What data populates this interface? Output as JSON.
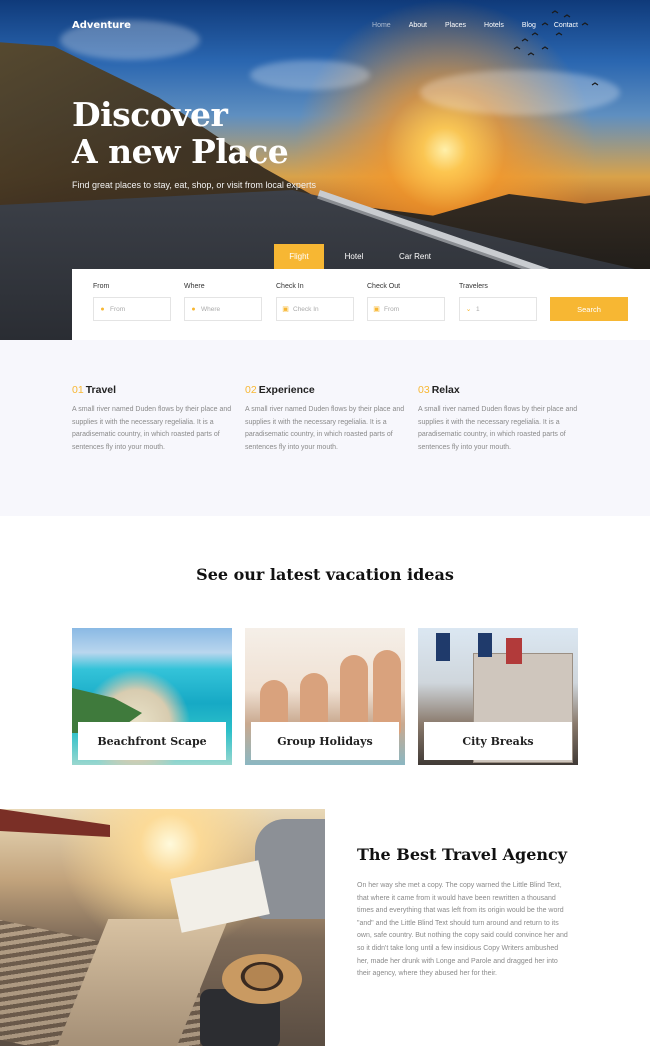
{
  "nav": {
    "brand": "Adventure",
    "items": [
      "Home",
      "About",
      "Places",
      "Hotels",
      "Blog",
      "Contact"
    ],
    "active_item": "Home"
  },
  "hero": {
    "title_line1": "Discover",
    "title_line2": "A new Place",
    "subtitle": "Find great places to stay, eat, shop, or visit from local experts"
  },
  "search": {
    "tabs": [
      "Flight",
      "Hotel",
      "Car Rent"
    ],
    "active_tab": "Flight",
    "fields": [
      {
        "label": "From",
        "placeholder": "From",
        "icon": "location-pin-icon"
      },
      {
        "label": "Where",
        "placeholder": "Where",
        "icon": "location-pin-icon"
      },
      {
        "label": "Check In",
        "placeholder": "Check In",
        "icon": "calendar-icon"
      },
      {
        "label": "Check Out",
        "placeholder": "From",
        "icon": "calendar-icon"
      },
      {
        "label": "Travelers",
        "placeholder": "1",
        "icon": "chevron-down-icon"
      }
    ],
    "button": "Search"
  },
  "features": [
    {
      "num": "01",
      "title": "Travel",
      "text": "A small river named Duden flows by their place and supplies it with the necessary regelialia. It is a paradisematic country, in which roasted parts of sentences fly into your mouth."
    },
    {
      "num": "02",
      "title": "Experience",
      "text": "A small river named Duden flows by their place and supplies it with the necessary regelialia. It is a paradisematic country, in which roasted parts of sentences fly into your mouth."
    },
    {
      "num": "03",
      "title": "Relax",
      "text": "A small river named Duden flows by their place and supplies it with the necessary regelialia. It is a paradisematic country, in which roasted parts of sentences fly into your mouth."
    }
  ],
  "vacation": {
    "title": "See our latest vacation ideas",
    "cards": [
      "Beachfront Scape",
      "Group Holidays",
      "City Breaks"
    ]
  },
  "agency": {
    "title": "The Best Travel Agency",
    "text": "On her way she met a copy. The copy warned the Little Blind Text, that where it came from it would have been rewritten a thousand times and everything that was left from its origin would be the word \"and\" and the Little Blind Text should turn around and return to its own, safe country. But nothing the copy said could convince her and so it didn't take long until a few insidious Copy Writers ambushed her, made her drunk with Longe and Parole and dragged her into their agency, where they abused her for their."
  },
  "colors": {
    "accent": "#f7b733",
    "features_bg": "#f7f7fc",
    "text_muted": "#8a8a8a"
  }
}
